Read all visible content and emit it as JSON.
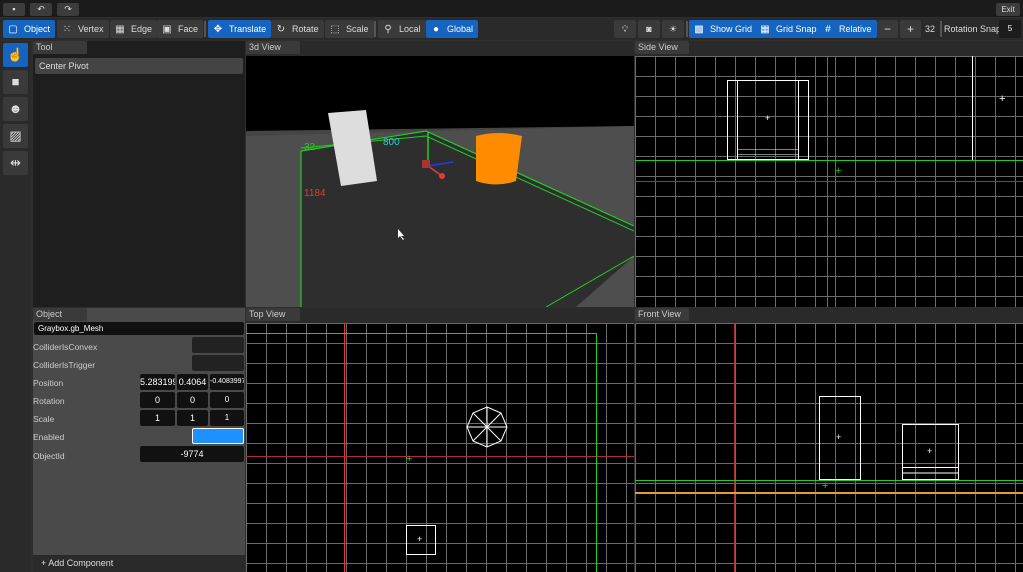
{
  "topbar": {
    "exit": "Exit",
    "icons": [
      "save-icon",
      "undo-icon",
      "redo-icon"
    ]
  },
  "toolbar": {
    "modes": [
      {
        "label": "Object",
        "active": true
      },
      {
        "label": "Vertex",
        "active": false
      },
      {
        "label": "Edge",
        "active": false
      },
      {
        "label": "Face",
        "active": false
      }
    ],
    "transforms": [
      {
        "label": "Translate",
        "active": true
      },
      {
        "label": "Rotate",
        "active": false
      },
      {
        "label": "Scale",
        "active": false
      }
    ],
    "spaces": [
      {
        "label": "Local",
        "active": false
      },
      {
        "label": "Global",
        "active": true
      }
    ],
    "show_grid": "Show Grid",
    "grid_snap": "Grid Snap",
    "relative": "Relative",
    "minus": "−",
    "plus": "+",
    "grid_size": "32",
    "rotation_snap_label": "Rotation Snap",
    "rotation_snap": "5"
  },
  "tool_panel": {
    "title": "Tool",
    "center_pivot": "Center Pivot"
  },
  "views": {
    "3d": "3d View",
    "side": "Side View",
    "top": "Top View",
    "front": "Front View"
  },
  "dims": {
    "a": "32",
    "b": "800",
    "c": "1184"
  },
  "object_panel": {
    "title": "Object",
    "name": "Graybox.gb_Mesh",
    "collider_convex": "ColliderIsConvex",
    "collider_trigger": "ColliderIsTrigger",
    "position_label": "Position",
    "position": [
      "5.283199",
      "0.4064",
      "-0.4083997"
    ],
    "rotation_label": "Rotation",
    "rotation": [
      "0",
      "0",
      "0"
    ],
    "scale_label": "Scale",
    "scale": [
      "1",
      "1",
      "1"
    ],
    "enabled_label": "Enabled",
    "enabled": true,
    "objectid_label": "ObjectId",
    "objectid": "-9774",
    "add_component": "Add Component"
  },
  "colors": {
    "accent": "#1565c0",
    "enabled": "#1e90ff",
    "x_axis": "#e53935",
    "z_axis": "#22cc22",
    "floor_line": "#e0a030"
  }
}
